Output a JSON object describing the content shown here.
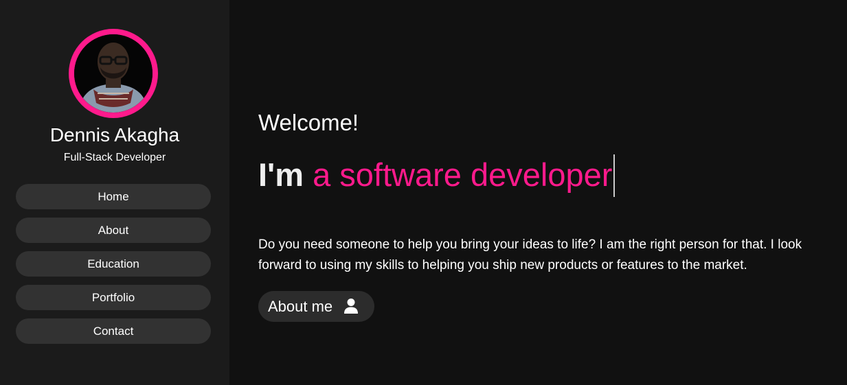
{
  "profile": {
    "name": "Dennis Akagha",
    "role": "Full-Stack Developer",
    "avatar_icon": "profile-photo",
    "ring_color": "#ff1a8c"
  },
  "nav": {
    "items": [
      {
        "label": "Home"
      },
      {
        "label": "About"
      },
      {
        "label": "Education"
      },
      {
        "label": "Portfolio"
      },
      {
        "label": "Contact"
      }
    ]
  },
  "hero": {
    "welcome": "Welcome!",
    "prefix": "I'm",
    "typed_text": "a software developer",
    "intro": "Do you need someone to help you bring your ideas to life? I am the right person for that. I look forward to using my skills to helping you ship new products or features to the market.",
    "accent_color": "#ff1a8c"
  },
  "cta": {
    "label": "About me",
    "icon": "user-icon"
  }
}
